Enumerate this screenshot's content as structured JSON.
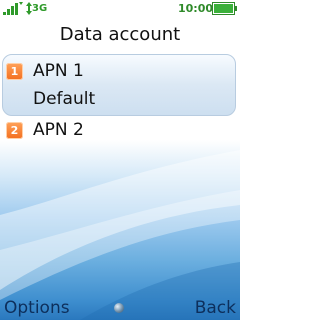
{
  "status_bar": {
    "network_type": "3G",
    "time": "10:00",
    "signal_icon": "signal-strength-icon",
    "battery_icon": "battery-icon",
    "accent_color": "#2f9a2a"
  },
  "screen": {
    "title": "Data account"
  },
  "list": {
    "items": [
      {
        "number": "1",
        "label": "APN 1",
        "sub_label": "Default",
        "selected": true
      },
      {
        "number": "2",
        "label": "APN 2",
        "selected": false
      }
    ],
    "badge_color": "#f36e1f"
  },
  "softkeys": {
    "left": "Options",
    "right": "Back",
    "center_icon": "center-dot-icon"
  }
}
